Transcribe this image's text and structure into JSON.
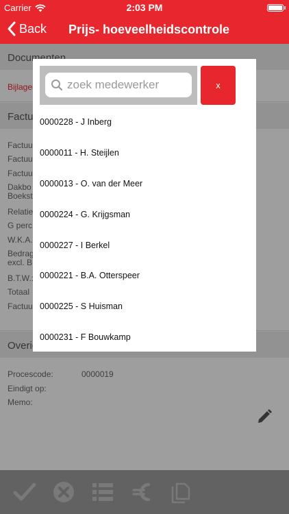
{
  "status_bar": {
    "carrier": "Carrier",
    "time": "2:03 PM"
  },
  "nav": {
    "back_label": "Back",
    "title": "Prijs- hoeveelheidscontrole"
  },
  "background": {
    "documenten_header": "Documenten",
    "bijlagen_link": "Bijlagen",
    "factuur_header": "Factuu",
    "factuur_rows": [
      "Factuu",
      "Factuu",
      "Factuu",
      "Dakbo",
      "Boekst",
      "Relatie",
      "G perc",
      "W.K.A.",
      "Bedrag",
      "excl. B",
      "B.T.W.:",
      "Totaal",
      "Factuu"
    ],
    "overige_header": "Overig",
    "procescode_label": "Procescode:",
    "procescode_value": "0000019",
    "eindigt_label": "Eindigt op:",
    "memo_label": "Memo:"
  },
  "modal": {
    "search_placeholder": "zoek medewerker",
    "search_value": "",
    "close_label": "x",
    "employees": [
      "0000228 - J Inberg",
      "0000011 - H. Steijlen",
      "0000013 - O. van der Meer",
      "0000224 - G. Krijgsman",
      "0000227 - I Berkel",
      "0000221 - B.A. Otterspeer",
      "0000225 - S Huisman",
      "0000231 - F Bouwkamp"
    ]
  },
  "toolbar": {
    "icons": [
      "checkmark-icon",
      "cancel-circle-icon",
      "list-icon",
      "euro-icon",
      "copy-icon"
    ]
  },
  "colors": {
    "brand_red": "#e8262d",
    "toolbar_gray": "#9e9e9e"
  }
}
